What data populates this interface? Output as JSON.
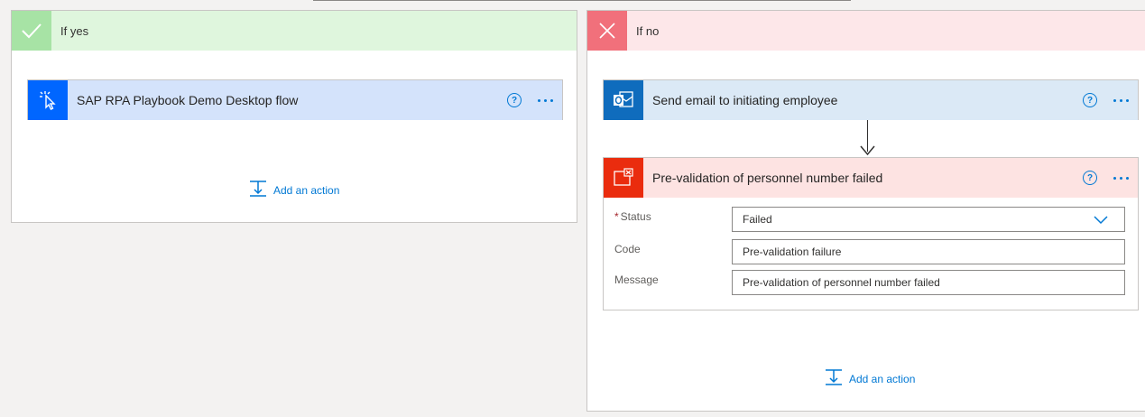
{
  "branch_yes": {
    "title": "If yes",
    "action": {
      "title": "SAP RPA Playbook Demo Desktop flow",
      "help": "?"
    },
    "add_action": "Add an action"
  },
  "branch_no": {
    "title": "If no",
    "email_action": {
      "title": "Send email to initiating employee",
      "help": "?"
    },
    "terminate_action": {
      "title": "Pre-validation of personnel number failed",
      "help": "?",
      "fields": {
        "status": {
          "required_mark": "*",
          "label": "Status",
          "value": "Failed"
        },
        "code": {
          "label": "Code",
          "value": "Pre-validation failure"
        },
        "message": {
          "label": "Message",
          "value": "Pre-validation of personnel number failed"
        }
      }
    },
    "add_action": "Add an action"
  },
  "colors": {
    "accent": "#0078d4",
    "yes_header": "#dff6dd",
    "no_header": "#fde7e9",
    "terminate_icon": "#ea2c0e"
  },
  "icons": [
    "check-icon",
    "close-icon",
    "desktop-flow-icon",
    "outlook-icon",
    "terminate-icon",
    "help-icon",
    "more-icon",
    "chevron-down-icon",
    "add-action-icon",
    "arrow-down-icon"
  ]
}
